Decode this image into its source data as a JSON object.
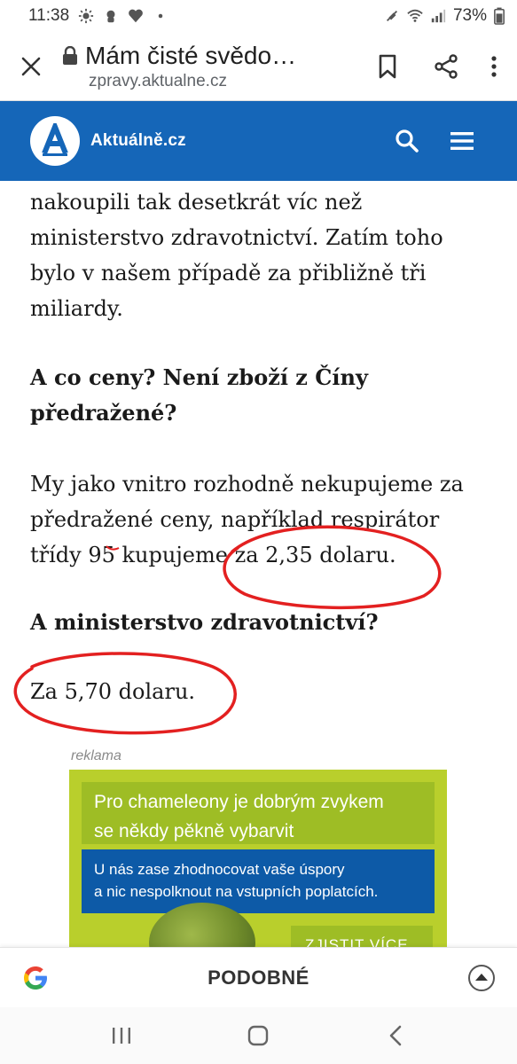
{
  "status_bar": {
    "time": "11:38",
    "battery": "73%",
    "notification_icons": [
      "sun-icon",
      "settings-icon",
      "heart-icon",
      "dot-icon"
    ]
  },
  "tab": {
    "title": "Mám čisté svědo…",
    "url": "zpravy.aktualne.cz"
  },
  "site": {
    "brand": "Aktuálně.cz",
    "logo_letter": "A",
    "header_color": "#1566b8"
  },
  "article": {
    "p1": [
      "nakoupili tak desetkrát víc než",
      "ministerstvo zdravotnictví. Zatím toho",
      "bylo v našem případě za přibližně tři",
      "miliardy."
    ],
    "q1": [
      "A co ceny? Není zboží z Číny",
      "předražené?"
    ],
    "p2": [
      "My jako vnitro rozhodně nekupujeme za",
      "předražené ceny, například respirátor",
      "třídy 95 kupujeme za 2,35 dolaru."
    ],
    "q2": "A ministerstvo zdravotnictví?",
    "p3": "Za 5,70 dolaru."
  },
  "ad": {
    "label": "reklama",
    "headline": [
      "Pro chameleony je dobrým zvykem",
      "se někdy pěkně vybarvit"
    ],
    "subline": [
      "U nás zase zhodnocovat vaše úspory",
      "a nic nespolknout na vstupních poplatcích."
    ],
    "cta": "ZJISTIT VÍCE"
  },
  "bottom_bar": {
    "label": "PODOBNÉ"
  },
  "annotation_color": "#e32020"
}
